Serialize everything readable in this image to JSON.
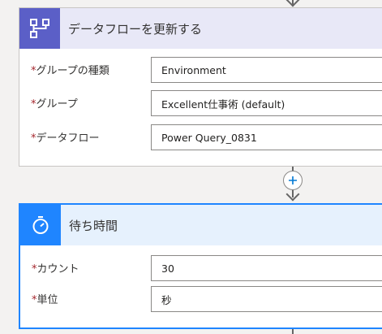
{
  "refresh_card": {
    "title": "データフローを更新する",
    "icon": "dataflow-icon",
    "accent_color": "#5b5fc7",
    "header_bg": "#e8e8f7",
    "fields": [
      {
        "label": "グループの種類",
        "required_mark": "*",
        "value": "Environment"
      },
      {
        "label": "グループ",
        "required_mark": "*",
        "value": "Excellent仕事術 (default)"
      },
      {
        "label": "データフロー",
        "required_mark": "*",
        "value": "Power Query_0831"
      }
    ]
  },
  "wait_card": {
    "title": "待ち時間",
    "icon": "timer-icon",
    "accent_color": "#1f85ff",
    "header_bg": "#e6f1fd",
    "fields": [
      {
        "label": "カウント",
        "required_mark": "*",
        "value": "30"
      },
      {
        "label": "単位",
        "required_mark": "*",
        "value": "秒"
      }
    ]
  },
  "add_step_icon": "plus-icon"
}
